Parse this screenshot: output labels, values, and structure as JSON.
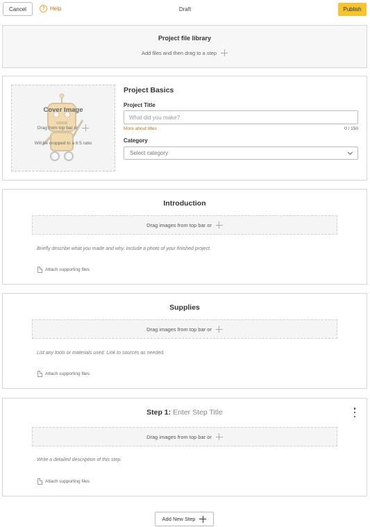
{
  "header": {
    "cancel_label": "Cancel",
    "help_label": "Help",
    "status": "Draft",
    "publish_label": "Publish"
  },
  "library": {
    "title": "Project file library",
    "subtitle": "Add files and then drag to a step"
  },
  "cover": {
    "title": "Cover Image",
    "drag_text": "Drag from top bar or",
    "ratio_text": "Will be cropped to a 6:5 ratio"
  },
  "basics": {
    "heading": "Project Basics",
    "title_label": "Project Title",
    "title_placeholder": "What did you make?",
    "title_value": "",
    "more_titles_link": "More about titles",
    "char_counter": "0 / 150",
    "category_label": "Category",
    "category_selected": "Select category"
  },
  "sections": {
    "intro": {
      "title": "Introduction",
      "dropzone": "Drag images from top bar or",
      "description": "Briefly describe what you made and why. Include a photo of your finished project.",
      "attach": "Attach supporting files"
    },
    "supplies": {
      "title": "Supplies",
      "dropzone": "Drag images from top bar or",
      "description": "List any tools or materials used. Link to sources as needed.",
      "attach": "Attach supporting files"
    },
    "step1": {
      "prefix": "Step 1:",
      "title_placeholder": "Enter Step Title",
      "dropzone": "Drag images from top bar or",
      "description": "Write a detailed description of this step.",
      "attach": "Attach supporting files"
    }
  },
  "footer": {
    "add_step_label": "Add New Step"
  },
  "colors": {
    "accent": "#f6c431",
    "link": "#c0721a"
  }
}
